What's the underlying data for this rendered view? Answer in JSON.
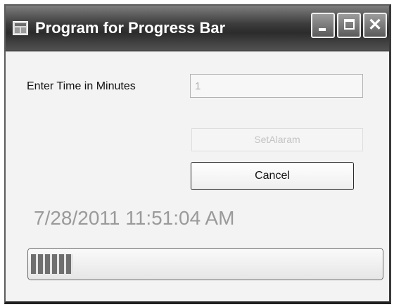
{
  "window": {
    "title": "Program for Progress Bar",
    "icon": "app-window-icon",
    "controls": {
      "minimize_icon": "minimize-icon",
      "maximize_icon": "maximize-icon",
      "close_icon": "close-icon",
      "close_glyph": "✕"
    }
  },
  "form": {
    "time_label": "Enter Time in Minutes",
    "time_value": "1",
    "set_alarm_label": "SetAlaram",
    "cancel_label": "Cancel",
    "datetime": "7/28/2011 11:51:04 AM",
    "progress_percent": 12
  }
}
